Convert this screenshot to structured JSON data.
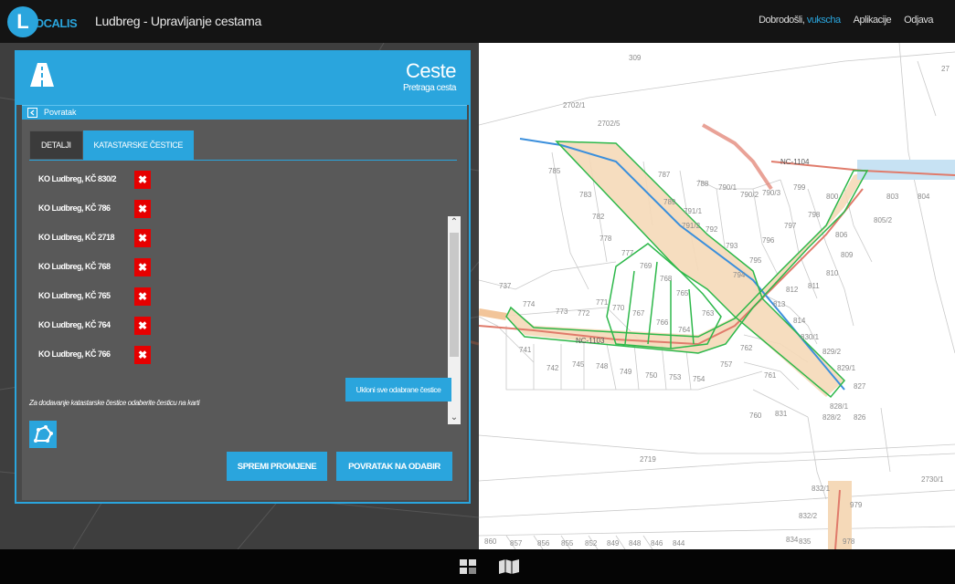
{
  "topbar": {
    "logo_letter": "L",
    "logo_word": "OCALIS",
    "app_title": "Ludbreg - Upravljanje cestama",
    "welcome": "Dobrodošli,",
    "username": "vukscha",
    "apps_label": "Aplikacije",
    "logout_label": "Odjava"
  },
  "panel": {
    "title": "Ceste",
    "subtitle": "Pretraga cesta",
    "back_label": "Povratak",
    "tabs": [
      {
        "label": "DETALJI"
      },
      {
        "label": "KATASTARSKE ČESTICE"
      }
    ],
    "parcels": [
      {
        "label": "KO Ludbreg, KČ 830/2"
      },
      {
        "label": "KO Ludbreg, KČ 786"
      },
      {
        "label": "KO Ludbreg, KČ 2718"
      },
      {
        "label": "KO Ludbreg, KČ 768"
      },
      {
        "label": "KO Ludbreg, KČ 765"
      },
      {
        "label": "KO Ludbreg, KČ 764"
      },
      {
        "label": "KO Ludbreg, KČ 766"
      }
    ],
    "delete_glyph": "✖",
    "remove_all_label": "Ukloni sve odabrane čestice",
    "hint": "Za dodavanje katastarske čestice odaberite česticu na karti",
    "save_label": "SPREMI PROMJENE",
    "return_label": "POVRATAK NA ODABIR"
  },
  "map": {
    "labels": [
      "309",
      "2702/1",
      "2702/5",
      "785",
      "787",
      "788",
      "790/1",
      "790/2",
      "790/3",
      "799",
      "800",
      "803",
      "804",
      "805/2",
      "783",
      "789",
      "791/1",
      "791/2",
      "792",
      "782",
      "778",
      "777",
      "793",
      "796",
      "797",
      "798",
      "806",
      "809",
      "795",
      "810",
      "769",
      "768",
      "794",
      "811",
      "812",
      "765",
      "763",
      "813",
      "814",
      "737",
      "774",
      "773",
      "772",
      "771",
      "770",
      "767",
      "766",
      "764",
      "741",
      "742",
      "745",
      "748",
      "749",
      "750",
      "753",
      "754",
      "757",
      "762",
      "761",
      "830/1",
      "829/2",
      "829/1",
      "827",
      "828/1",
      "828/2",
      "826",
      "760",
      "831",
      "2719",
      "2730/1",
      "832/1",
      "832/2",
      "979",
      "834",
      "835",
      "978",
      "860",
      "857",
      "856",
      "855",
      "852",
      "849",
      "848",
      "846",
      "844",
      "27"
    ],
    "road_labels": [
      "NC-1104",
      "NC-1103"
    ]
  },
  "colors": {
    "accent": "#2aa5dd",
    "delete": "#e60000",
    "parcel_outline": "#2db84a",
    "parcel_fill": "#f5d9b8",
    "road_red": "#e07b6b",
    "road_blue": "#3b8fdc"
  },
  "icons": {
    "road": "road-icon",
    "back": "back-arrow-icon",
    "select": "polygon-select-icon",
    "grid": "grid-icon",
    "map": "map-icon"
  }
}
